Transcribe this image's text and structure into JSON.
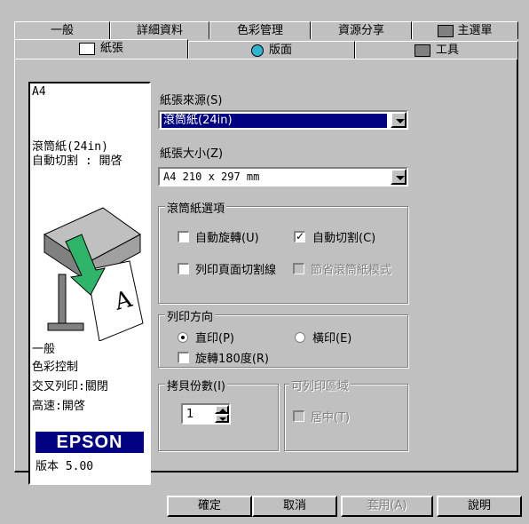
{
  "tabs_row1": [
    "一般",
    "詳細資料",
    "色彩管理",
    "資源分享",
    "主選單"
  ],
  "tabs_row2": [
    "紙張",
    "版面",
    "工具"
  ],
  "preview": {
    "paper_size": "A4",
    "paper_source": "滾筒紙(24in)",
    "auto_cut": "自動切割 : 開啓",
    "settings": [
      "一般",
      "色彩控制",
      "交叉列印:關閉",
      "高速:開啓"
    ],
    "brand": "EPSON",
    "version": "版本 5.00"
  },
  "paper_source": {
    "label": "紙張來源(S)",
    "value": "滾筒紙(24in)"
  },
  "paper_size": {
    "label": "紙張大小(Z)",
    "value": "A4 210 x 297 mm"
  },
  "roll_options": {
    "title": "滾筒紙選項",
    "auto_rotate": {
      "label": "自動旋轉(U)",
      "checked": false
    },
    "auto_cut": {
      "label": "自動切割(C)",
      "checked": true
    },
    "print_page_line": {
      "label": "列印頁面切割線",
      "checked": false
    },
    "save_roll_paper": {
      "label": "節省滾筒紙模式",
      "checked": false
    }
  },
  "orientation": {
    "title": "列印方向",
    "portrait": {
      "label": "直印(P)",
      "selected": true
    },
    "landscape": {
      "label": "橫印(E)",
      "selected": false
    },
    "rotate180": {
      "label": "旋轉180度(R)",
      "checked": false
    }
  },
  "copies": {
    "title": "拷貝份數(I)",
    "value": "1"
  },
  "printable_area": {
    "title": "可列印區域",
    "center": {
      "label": "居中(T)",
      "checked": false
    }
  },
  "buttons": {
    "ok": "確定",
    "cancel": "取消",
    "apply": "套用(A)",
    "help": "說明"
  },
  "colors": {
    "face": "#c0c0c0",
    "highlight": "#000080",
    "arrow_green": "#2fb56a"
  }
}
